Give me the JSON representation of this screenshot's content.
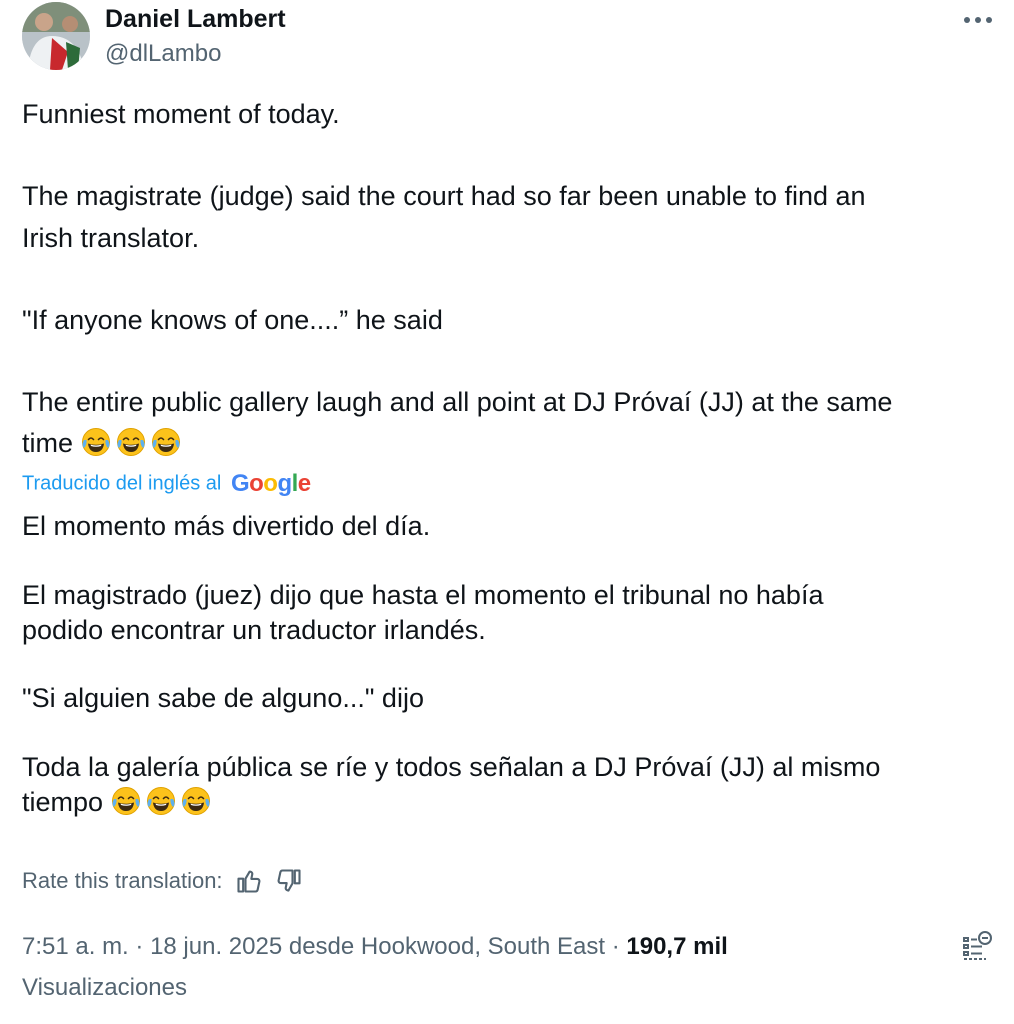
{
  "author": {
    "name": "Daniel Lambert",
    "handle": "@dlLambo"
  },
  "original": {
    "line1": "Funniest moment of today.",
    "line2a": "The magistrate (judge) said the court had so far been unable to find an",
    "line2b": "Irish translator.",
    "line3": "\"If anyone knows of one....” he said",
    "line4a": "The entire public gallery laugh and all point at DJ Próvaí (JJ) at the same",
    "line4b": "time"
  },
  "translation_credit": {
    "label": "Traducido del inglés al",
    "brand": "Google",
    "brand_colors": [
      "#4285f4",
      "#ea4335",
      "#fbbc05",
      "#4285f4",
      "#34a853",
      "#ea4335"
    ]
  },
  "translated": {
    "line1": "El momento más divertido del día.",
    "line2a": "El magistrado (juez) dijo que hasta el momento el tribunal no había",
    "line2b": "podido encontrar un traductor irlandés.",
    "line3": "\"Si alguien sabe de alguno...\" dijo",
    "line4a": "Toda la galería pública se ríe y todos señalan a DJ Próvaí (JJ) al mismo",
    "line4b": "tiempo"
  },
  "emoji": [
    "face-with-tears-of-joy",
    "face-with-tears-of-joy",
    "face-with-tears-of-joy"
  ],
  "rating": {
    "label": "Rate this translation:",
    "up_icon": "thumbs-up-icon",
    "down_icon": "thumbs-down-icon"
  },
  "meta": {
    "time": "7:51 a. m.",
    "sep1": " · ",
    "date": "18 jun. 2025",
    "location": " desde Hookwood, South East",
    "sep2": " · ",
    "views": "190,7 mil",
    "views_label": "Visualizaciones"
  },
  "colors": {
    "text": "#0f1419",
    "secondary": "#536471",
    "link": "#1d9bf0"
  }
}
